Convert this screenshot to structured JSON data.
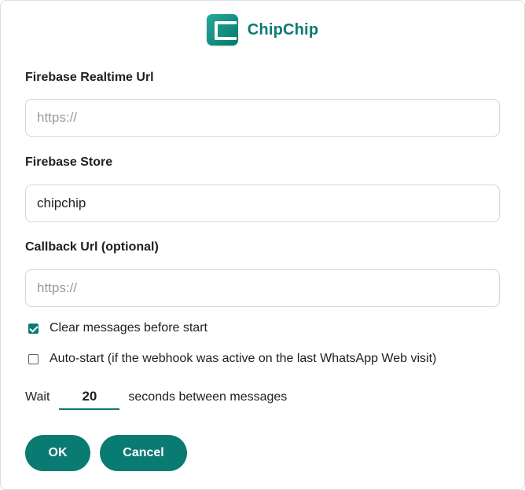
{
  "header": {
    "logo_icon": "chipchip-c-logo-icon",
    "brand_name": "ChipChip",
    "brand_color": "#0a7b72"
  },
  "fields": {
    "firebase_realtime_url": {
      "label": "Firebase Realtime Url",
      "value": "",
      "placeholder": "https://"
    },
    "firebase_store": {
      "label": "Firebase Store",
      "value": "chipchip",
      "placeholder": ""
    },
    "callback_url": {
      "label": "Callback Url (optional)",
      "value": "",
      "placeholder": "https://"
    }
  },
  "options": {
    "clear_messages": {
      "label": "Clear messages before start",
      "checked": true
    },
    "auto_start": {
      "label": "Auto-start (if the webhook was active on the last WhatsApp Web visit)",
      "checked": false
    }
  },
  "wait": {
    "prefix": "Wait",
    "value": "20",
    "suffix": "seconds between messages"
  },
  "buttons": {
    "ok_label": "OK",
    "cancel_label": "Cancel"
  }
}
